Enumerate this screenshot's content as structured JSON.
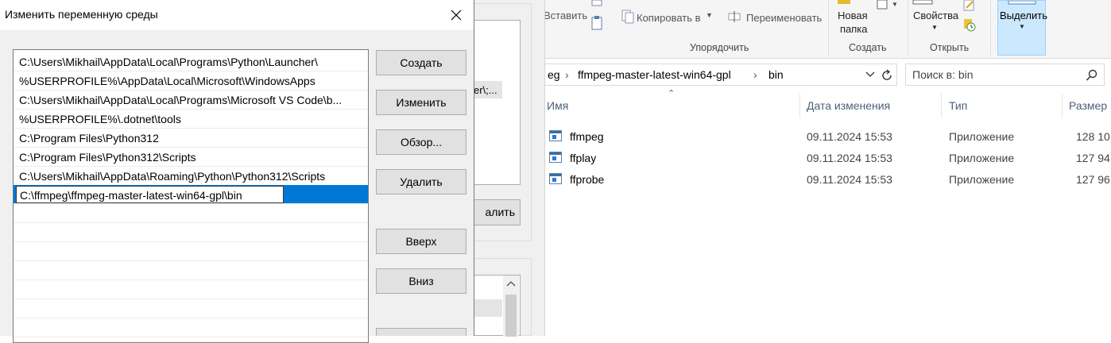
{
  "dialog": {
    "title": "Изменить переменную среды",
    "paths": [
      "C:\\Users\\Mikhail\\AppData\\Local\\Programs\\Python\\Launcher\\",
      "%USERPROFILE%\\AppData\\Local\\Microsoft\\WindowsApps",
      "C:\\Users\\Mikhail\\AppData\\Local\\Programs\\Microsoft VS Code\\b...",
      "%USERPROFILE%\\.dotnet\\tools",
      "C:\\Program Files\\Python312",
      "C:\\Program Files\\Python312\\Scripts",
      "C:\\Users\\Mikhail\\AppData\\Roaming\\Python\\Python312\\Scripts"
    ],
    "editing_value": "C:\\ffmpeg\\ffmpeg-master-latest-win64-gpl\\bin",
    "buttons": {
      "create": "Создать",
      "edit": "Изменить",
      "browse": "Обзор...",
      "delete": "Удалить",
      "up": "Вверх",
      "down": "Вниз"
    }
  },
  "background_dialog": {
    "partial_text": "er\\;...",
    "partial_button": "алить"
  },
  "explorer": {
    "ribbon": {
      "paste": "Вставить",
      "copy_to": "Копировать в",
      "rename": "Переименовать",
      "new_folder_line1": "Новая",
      "new_folder_line2": "папка",
      "properties": "Свойства",
      "select": "Выделить",
      "groups": {
        "organize": "Упорядочить",
        "create": "Создать",
        "open": "Открыть"
      }
    },
    "breadcrumb": [
      "eg",
      "ffmpeg-master-latest-win64-gpl",
      "bin"
    ],
    "search_placeholder": "Поиск в: bin",
    "columns": {
      "name": "Имя",
      "date": "Дата изменения",
      "type": "Тип",
      "size": "Размер"
    },
    "files": [
      {
        "name": "ffmpeg",
        "date": "09.11.2024 15:53",
        "type": "Приложение",
        "size": "128 10"
      },
      {
        "name": "ffplay",
        "date": "09.11.2024 15:53",
        "type": "Приложение",
        "size": "127 94"
      },
      {
        "name": "ffprobe",
        "date": "09.11.2024 15:53",
        "type": "Приложение",
        "size": "127 96"
      }
    ]
  },
  "colors": {
    "selection": "#0078d7",
    "dialog_bg": "#f0f0f0",
    "button_bg": "#e1e1e1",
    "header_text": "#4c607a"
  }
}
